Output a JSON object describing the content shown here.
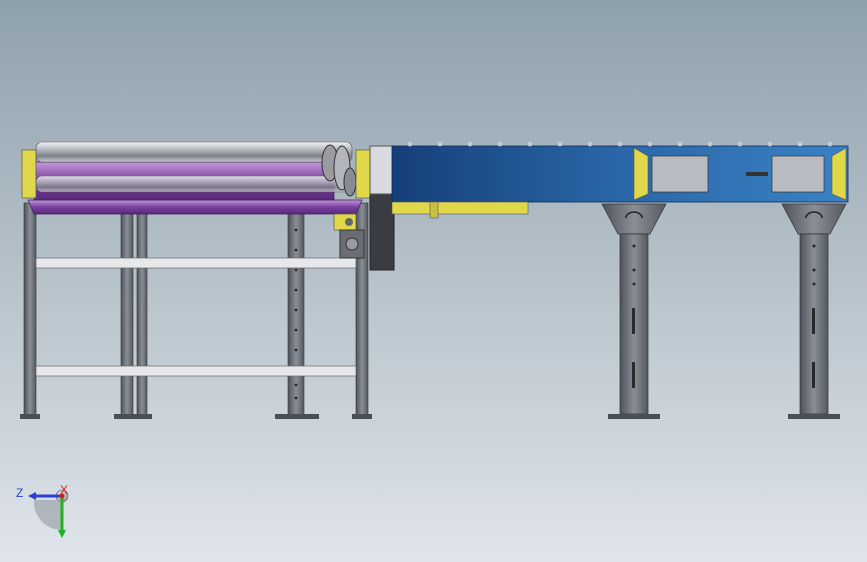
{
  "viewport": {
    "background_top": "#8fa0ad",
    "background_bottom": "#dfe5ea"
  },
  "model": {
    "roller_section_color": "#7a3fa0",
    "belt_section_color": "#2a67a8",
    "bracket_color": "#e0d84a",
    "leg_color": "#6b6f78"
  },
  "triad": {
    "axis_z_label": "Z",
    "axis_x_label": "X",
    "z_color": "#2b3fd0",
    "x_color": "#d02020",
    "y_color": "#20b020"
  }
}
